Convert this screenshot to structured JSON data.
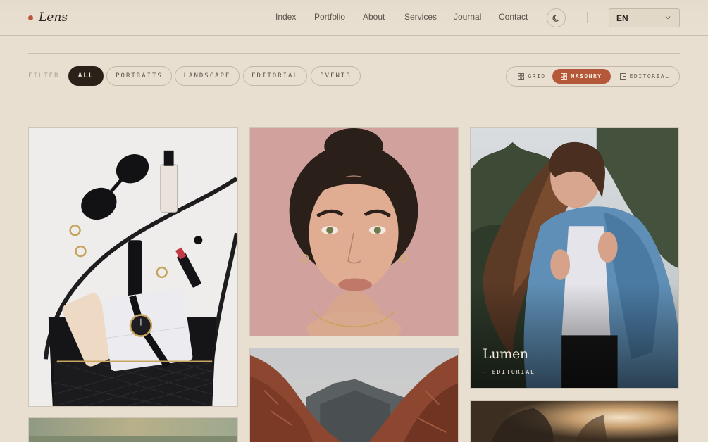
{
  "brand": {
    "name": "Lens"
  },
  "nav": {
    "items": [
      "Index",
      "Portfolio",
      "About",
      "Services",
      "Journal",
      "Contact"
    ],
    "theme_icon": "moon-icon",
    "language": "EN"
  },
  "filter": {
    "label": "FILTER",
    "options": [
      "ALL",
      "PORTRAITS",
      "LANDSCAPE",
      "EDITORIAL",
      "EVENTS"
    ],
    "selected": "ALL"
  },
  "view": {
    "options": [
      {
        "label": "GRID",
        "icon": "grid-icon"
      },
      {
        "label": "MASONRY",
        "icon": "masonry-icon"
      },
      {
        "label": "EDITORIAL",
        "icon": "editorial-layout-icon"
      }
    ],
    "selected": "MASONRY"
  },
  "gallery": {
    "items": [
      {
        "id": "flatlay",
        "title": "",
        "category": ""
      },
      {
        "id": "portrait-pink",
        "title": "",
        "category": ""
      },
      {
        "id": "portrait-denim",
        "title": "Lumen",
        "category": "— EDITORIAL"
      },
      {
        "id": "canyon",
        "title": "",
        "category": ""
      },
      {
        "id": "field",
        "title": "",
        "category": ""
      },
      {
        "id": "backlit",
        "title": "",
        "category": ""
      }
    ]
  },
  "colors": {
    "background": "#e8dfd0",
    "accent": "#b5583a",
    "active_pill": "#2b2119",
    "border": "#c2b8a9"
  }
}
